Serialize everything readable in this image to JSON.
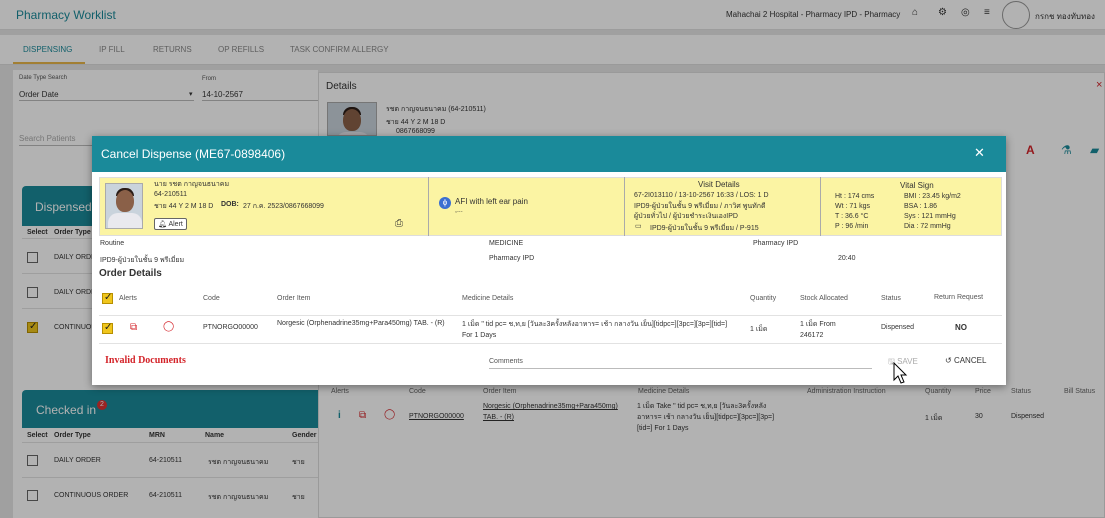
{
  "app": {
    "title": "Pharmacy Worklist",
    "hospital": "Mahachai 2 Hospital - Pharmacy IPD - Pharmacy",
    "user": "กรกช ทองทับทอง"
  },
  "tabs": [
    "DISPENSING",
    "IP FILL",
    "RETURNS",
    "OP REFILLS",
    "TASK CONFIRM ALLERGY"
  ],
  "filters": {
    "date_type_label": "Date Type Search",
    "date_type_value": "Order Date",
    "from_label": "From",
    "from_value": "14-10-2567",
    "search_placeholder": "Search Patients"
  },
  "dispensed": {
    "title": "Dispensed",
    "columns": [
      "Select",
      "Order Type"
    ],
    "rows": [
      {
        "order_type": "DAILY ORDE",
        "checked": false
      },
      {
        "order_type": "DAILY ORDE",
        "checked": false
      },
      {
        "order_type": "CONTINUOU",
        "checked": true
      }
    ]
  },
  "checked_in": {
    "title": "Checked in",
    "badge": "2",
    "columns": [
      "Select",
      "Order Type",
      "MRN",
      "Name",
      "Gender"
    ],
    "rows": [
      {
        "order_type": "DAILY ORDER",
        "mrn": "64-210511",
        "name": "รชต กาญจนธนาคม",
        "gender": "ชาย"
      },
      {
        "order_type": "CONTINUOUS ORDER",
        "mrn": "64-210511",
        "name": "รชต กาญจนธนาคม",
        "gender": "ชาย"
      }
    ]
  },
  "details": {
    "title": "Details",
    "patient_name": "รชต กาญจนธนาคม (64-210511)",
    "patient_age": "ชาย 44 Y 2 M 18 D",
    "patient_phone": "0867668099",
    "table_headers": [
      "Alerts",
      "Code",
      "Order Item",
      "Medicine Details",
      "Administration Instruction",
      "Quantity",
      "Price",
      "Status",
      "Bill Status"
    ],
    "row": {
      "code": "PTNORGO00000",
      "item": "Norgesic (Orphenadrine35mg+Para450mg) TAB. - (R)",
      "details": "1 เม็ด Take \" tid pc= ช,ท,ย [วันละ3ครั้งหลังอาหาร= เช้า กลางวัน เย็น][tidpc=][3pc=][3p=][tid=] For 1 Days",
      "quantity": "1 เม็ด",
      "price": "30",
      "status": "Dispensed"
    }
  },
  "modal": {
    "title": "Cancel Dispense (ME67-0898406)",
    "patient": {
      "name": "นาย รชต กาญจนธนาคม",
      "mrn": "64-210511",
      "age_line": "ชาย 44 Y 2 M 18 D",
      "dob_label": "DOB:",
      "dob_value": "27 ก.ค. 2523/0867668099",
      "alert_label": "Alert"
    },
    "diagnosis": "AFI with left ear pain",
    "diagnosis_more": ",...",
    "visit": {
      "title": "Visit Details",
      "line1": "67-2I013110 / 13-10-2567 16:33 / LOS: 1 D",
      "line2": "IPD9-ผู้ป่วยในชั้น 9 พรีเมี่ยม / ภาวิศ พูนทักดี",
      "line3": "ผู้ป่วยทั่วไป / ผู้ป่วยชำระเงินเองIPD",
      "line4": "IPD9-ผู้ป่วยในชั้น 9 พรีเมี่ยม / P-915"
    },
    "vitals": {
      "title": "Vital Sign",
      "ht": "Ht : 174 cms",
      "wt": "Wt : 71 kgs",
      "t": "T : 36.6 °C",
      "p": "P : 96 /min",
      "bmi": "BMI : 23.45 kg/m2",
      "bsa": "BSA : 1.86",
      "sys": "Sys : 121 mmHg",
      "dia": "Dia : 72 mmHg"
    },
    "meta": {
      "routine": "Routine",
      "medicine": "MEDICINE",
      "pharmacy1": "Pharmacy IPD",
      "ward": "IPD9-ผู้ป่วยในชั้น 9 พรีเมี่ยม",
      "pharmacy2": "Pharmacy IPD",
      "time": "20:40"
    },
    "order_details_title": "Order Details",
    "columns": [
      "Alerts",
      "Code",
      "Order Item",
      "Medicine Details",
      "Quantity",
      "Stock Allocated",
      "Status",
      "Return Request"
    ],
    "row": {
      "code": "PTNORGO00000",
      "item": "Norgesic (Orphenadrine35mg+Para450mg) TAB. - (R)",
      "details": "1 เม็ด \" tid pc= ช,ท,ย [วันละ3ครั้งหลังอาหาร= เช้า กลางวัน เย็น][tidpc=][3pc=][3p=][tid=] For 1 Days",
      "quantity": "1 เม็ด",
      "stock": "1 เม็ด From 246172",
      "status": "Dispensed",
      "return_request": "NO"
    },
    "invalid_documents": "Invalid Documents",
    "comments_label": "Comments",
    "save_label": "SAVE",
    "cancel_label": "CANCEL"
  }
}
